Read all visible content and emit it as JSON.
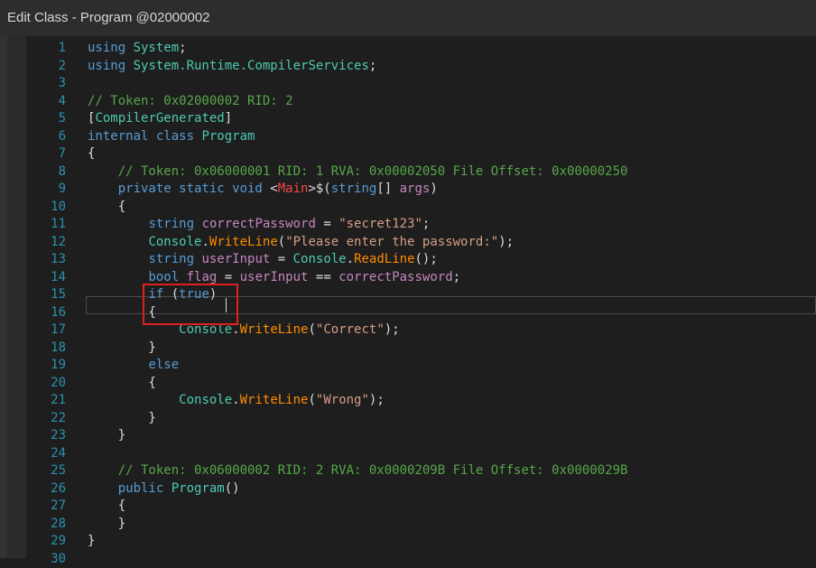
{
  "window": {
    "title": "Edit Class - Program @02000002"
  },
  "editor": {
    "lines": [
      [
        {
          "t": "using ",
          "c": "kw"
        },
        {
          "t": "System",
          "c": "ty"
        },
        {
          "t": ";",
          "c": "pl"
        }
      ],
      [
        {
          "t": "using ",
          "c": "kw"
        },
        {
          "t": "System.Runtime.CompilerServices",
          "c": "ty"
        },
        {
          "t": ";",
          "c": "pl"
        }
      ],
      [],
      [
        {
          "t": "// Token: 0x02000002 RID: 2",
          "c": "cm"
        }
      ],
      [
        {
          "t": "[",
          "c": "pl"
        },
        {
          "t": "CompilerGenerated",
          "c": "ty"
        },
        {
          "t": "]",
          "c": "pl"
        }
      ],
      [
        {
          "t": "internal class ",
          "c": "kw"
        },
        {
          "t": "Program",
          "c": "ty"
        }
      ],
      [
        {
          "t": "{",
          "c": "pl"
        }
      ],
      [
        {
          "t": "    ",
          "c": "pl"
        },
        {
          "t": "// Token: 0x06000001 RID: 1 RVA: 0x00002050 File Offset: 0x00000250",
          "c": "cm"
        }
      ],
      [
        {
          "t": "    ",
          "c": "pl"
        },
        {
          "t": "private static void ",
          "c": "kw"
        },
        {
          "t": "<",
          "c": "pl"
        },
        {
          "t": "Main",
          "c": "rd"
        },
        {
          "t": ">$(",
          "c": "pl"
        },
        {
          "t": "string",
          "c": "kw"
        },
        {
          "t": "[] ",
          "c": "pl"
        },
        {
          "t": "args",
          "c": "va"
        },
        {
          "t": ")",
          "c": "pl"
        }
      ],
      [
        {
          "t": "    {",
          "c": "pl"
        }
      ],
      [
        {
          "t": "        ",
          "c": "pl"
        },
        {
          "t": "string ",
          "c": "kw"
        },
        {
          "t": "correctPassword",
          "c": "va"
        },
        {
          "t": " = ",
          "c": "pl"
        },
        {
          "t": "\"secret123\"",
          "c": "st"
        },
        {
          "t": ";",
          "c": "pl"
        }
      ],
      [
        {
          "t": "        ",
          "c": "pl"
        },
        {
          "t": "Console",
          "c": "ty"
        },
        {
          "t": ".",
          "c": "pl"
        },
        {
          "t": "WriteLine",
          "c": "me"
        },
        {
          "t": "(",
          "c": "pl"
        },
        {
          "t": "\"Please enter the password:\"",
          "c": "st"
        },
        {
          "t": ");",
          "c": "pl"
        }
      ],
      [
        {
          "t": "        ",
          "c": "pl"
        },
        {
          "t": "string ",
          "c": "kw"
        },
        {
          "t": "userInput",
          "c": "va"
        },
        {
          "t": " = ",
          "c": "pl"
        },
        {
          "t": "Console",
          "c": "ty"
        },
        {
          "t": ".",
          "c": "pl"
        },
        {
          "t": "ReadLine",
          "c": "me"
        },
        {
          "t": "();",
          "c": "pl"
        }
      ],
      [
        {
          "t": "        ",
          "c": "pl"
        },
        {
          "t": "bool ",
          "c": "kw"
        },
        {
          "t": "flag",
          "c": "va"
        },
        {
          "t": " = ",
          "c": "pl"
        },
        {
          "t": "userInput",
          "c": "va"
        },
        {
          "t": " == ",
          "c": "pl"
        },
        {
          "t": "correctPassword",
          "c": "va"
        },
        {
          "t": ";",
          "c": "pl"
        }
      ],
      [
        {
          "t": "        ",
          "c": "pl"
        },
        {
          "t": "if ",
          "c": "kw"
        },
        {
          "t": "(",
          "c": "pl"
        },
        {
          "t": "true",
          "c": "kw"
        },
        {
          "t": ")",
          "c": "pl"
        }
      ],
      [
        {
          "t": "        {",
          "c": "pl"
        }
      ],
      [
        {
          "t": "            ",
          "c": "pl"
        },
        {
          "t": "Console",
          "c": "ty"
        },
        {
          "t": ".",
          "c": "pl"
        },
        {
          "t": "WriteLine",
          "c": "me"
        },
        {
          "t": "(",
          "c": "pl"
        },
        {
          "t": "\"Correct\"",
          "c": "st"
        },
        {
          "t": ");",
          "c": "pl"
        }
      ],
      [
        {
          "t": "        }",
          "c": "pl"
        }
      ],
      [
        {
          "t": "        ",
          "c": "pl"
        },
        {
          "t": "else",
          "c": "kw"
        }
      ],
      [
        {
          "t": "        {",
          "c": "pl"
        }
      ],
      [
        {
          "t": "            ",
          "c": "pl"
        },
        {
          "t": "Console",
          "c": "ty"
        },
        {
          "t": ".",
          "c": "pl"
        },
        {
          "t": "WriteLine",
          "c": "me"
        },
        {
          "t": "(",
          "c": "pl"
        },
        {
          "t": "\"Wrong\"",
          "c": "st"
        },
        {
          "t": ");",
          "c": "pl"
        }
      ],
      [
        {
          "t": "        }",
          "c": "pl"
        }
      ],
      [
        {
          "t": "    }",
          "c": "pl"
        }
      ],
      [],
      [
        {
          "t": "    ",
          "c": "pl"
        },
        {
          "t": "// Token: 0x06000002 RID: 2 RVA: 0x0000209B File Offset: 0x0000029B",
          "c": "cm"
        }
      ],
      [
        {
          "t": "    ",
          "c": "pl"
        },
        {
          "t": "public ",
          "c": "kw"
        },
        {
          "t": "Program",
          "c": "ty"
        },
        {
          "t": "()",
          "c": "pl"
        }
      ],
      [
        {
          "t": "    {",
          "c": "pl"
        }
      ],
      [
        {
          "t": "    }",
          "c": "pl"
        }
      ],
      [
        {
          "t": "}",
          "c": "pl"
        }
      ],
      []
    ],
    "current_line_number": 15,
    "highlight_color": "#e02020"
  }
}
